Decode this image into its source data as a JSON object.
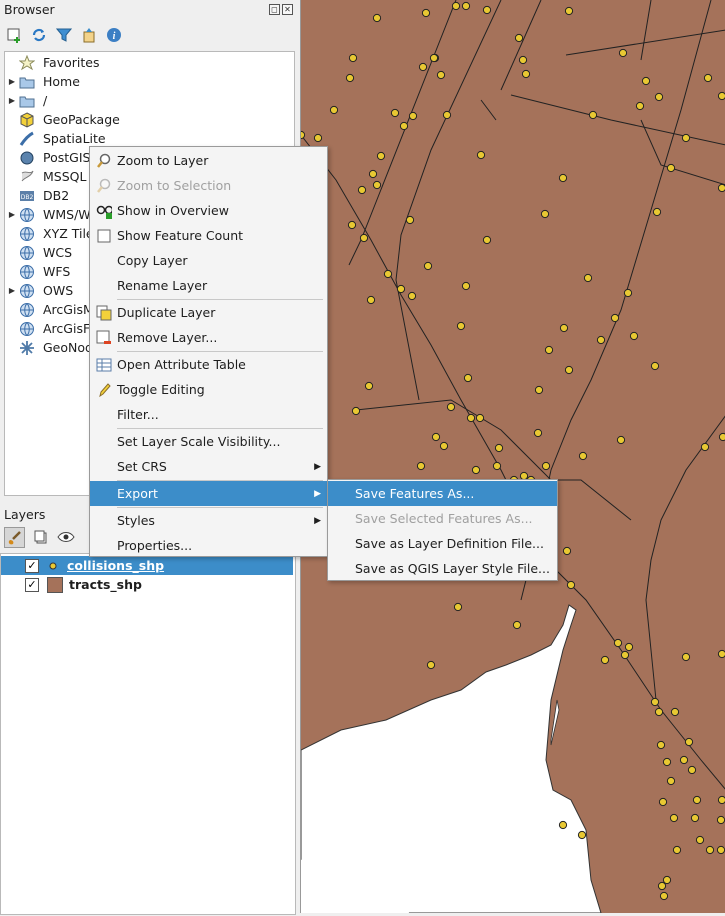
{
  "browser": {
    "title": "Browser",
    "items": [
      {
        "label": "Favorites",
        "icon": "star-icon",
        "expandable": false
      },
      {
        "label": "Home",
        "icon": "folder-icon",
        "expandable": true
      },
      {
        "label": "/",
        "icon": "folder-icon",
        "expandable": true
      },
      {
        "label": "GeoPackage",
        "icon": "geopackage-icon",
        "expandable": false
      },
      {
        "label": "SpatiaLite",
        "icon": "spatialite-icon",
        "expandable": false
      },
      {
        "label": "PostGIS",
        "icon": "postgis-icon",
        "expandable": false
      },
      {
        "label": "MSSQL",
        "icon": "mssql-icon",
        "expandable": false
      },
      {
        "label": "DB2",
        "icon": "db2-icon",
        "expandable": false
      },
      {
        "label": "WMS/WMTS",
        "icon": "globe-icon",
        "expandable": true
      },
      {
        "label": "XYZ Tiles",
        "icon": "globe-icon",
        "expandable": false
      },
      {
        "label": "WCS",
        "icon": "globe-icon",
        "expandable": false
      },
      {
        "label": "WFS",
        "icon": "globe-icon",
        "expandable": false
      },
      {
        "label": "OWS",
        "icon": "globe-icon",
        "expandable": true
      },
      {
        "label": "ArcGisMapServer",
        "icon": "globe-icon",
        "expandable": false
      },
      {
        "label": "ArcGisFeatureServer",
        "icon": "globe-icon",
        "expandable": false
      },
      {
        "label": "GeoNode",
        "icon": "geonode-icon",
        "expandable": false
      }
    ]
  },
  "layers": {
    "title": "Layers",
    "items": [
      {
        "label": "collisions_shp",
        "checked": "✓",
        "selected": true
      },
      {
        "label": "tracts_shp",
        "checked": "✓",
        "selected": false
      }
    ]
  },
  "context_menu": {
    "items": [
      {
        "label": "Zoom to Layer",
        "u": "Z",
        "rest": "oom to Layer",
        "icon": "zoom-icon",
        "disabled": false
      },
      {
        "label": "Zoom to Selection",
        "u": "Z",
        "rest": "oom to Selection",
        "icon": "zoom-icon",
        "disabled": true
      },
      {
        "label": "Show in Overview",
        "u": "S",
        "rest": "how in Overview",
        "icon": "overview-icon",
        "disabled": false
      },
      {
        "label": "Show Feature Count",
        "icon": "checkbox-icon",
        "disabled": false
      },
      {
        "label": "Copy Layer",
        "disabled": false
      },
      {
        "label": "Rename Layer",
        "pre": "Re",
        "u": "n",
        "rest": "ame Layer",
        "disabled": false
      },
      {
        "label": "Duplicate Layer",
        "u": "D",
        "rest": "uplicate Layer",
        "icon": "duplicate-icon",
        "disabled": false
      },
      {
        "label": "Remove Layer...",
        "u": "R",
        "rest": "emove Layer...",
        "icon": "remove-icon",
        "disabled": false
      },
      {
        "label": "Open Attribute Table",
        "u": "O",
        "rest": "pen Attribute Table",
        "icon": "table-icon",
        "disabled": false
      },
      {
        "label": "Toggle Editing",
        "icon": "pencil-icon",
        "disabled": false
      },
      {
        "label": "Filter...",
        "u": "F",
        "rest": "ilter...",
        "disabled": false
      },
      {
        "label": "Set Layer Scale Visibility...",
        "u": "S",
        "rest": "et Layer Scale Visibility...",
        "disabled": false
      },
      {
        "label": "Set CRS",
        "disabled": false,
        "submenu": true
      },
      {
        "label": "Export",
        "disabled": false,
        "submenu": true,
        "highlighted": true
      },
      {
        "label": "Styles",
        "disabled": false,
        "submenu": true
      },
      {
        "label": "Properties...",
        "u": "P",
        "rest": "roperties...",
        "disabled": false
      }
    ]
  },
  "export_submenu": {
    "items": [
      {
        "label": "Save Features As...",
        "disabled": false,
        "highlighted": true
      },
      {
        "label": "Save Selected Features As...",
        "disabled": true
      },
      {
        "label": "Save as Layer Definition File...",
        "disabled": false
      },
      {
        "label": "Save as QGIS Layer Style File...",
        "disabled": false
      }
    ]
  },
  "colors": {
    "polygon_fill": "#a5725a",
    "point_fill": "#e8c833",
    "highlight": "#3c8dc9"
  }
}
